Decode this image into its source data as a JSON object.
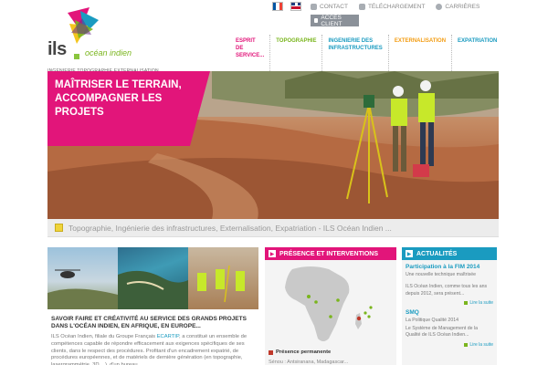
{
  "logo": {
    "name": "ils",
    "suffix": "océan indien",
    "tagline": "INGENIERIE TOPOGRAPHIE EXTERNALISATION"
  },
  "languages": [
    "fr",
    "en"
  ],
  "top_links": {
    "contact": "CONTACT",
    "telechargement": "TÉLÉCHARGEMENT",
    "carrieres": "CARRIÈRES",
    "acces_client": "ACCÈS CLIENT"
  },
  "nav": {
    "items": [
      {
        "label": "ESPRIT DE SERVICE..."
      },
      {
        "label": "TOPOGRAPHIE"
      },
      {
        "label": "INGENIERIE DES INFRASTRUCTURES"
      },
      {
        "label": "EXTERNALISATION"
      },
      {
        "label": "EXPATRIATION"
      }
    ]
  },
  "hero": {
    "headline": "MAÎTRISER LE TERRAIN, ACCOMPAGNER LES PROJETS"
  },
  "tagline": "Topographie, Ingénierie des infrastructures, Externalisation, Expatriation - ILS Océan Indien ...",
  "savoir": {
    "title": "SAVOIR FAIRE ET CRÉATIVITÉ AU SERVICE DES GRANDS PROJETS DANS L'OCÉAN INDIEN, EN AFRIQUE, EN EUROPE...",
    "text_before": "ILS Océan Indien, filiale du Groupe Français ",
    "link": "ECARTIP",
    "text_after": ", a constitué un ensemble de compétences capable de répondre efficacement aux exigences spécifiques de ses clients, dans le respect des procédures. Profitant d'un encadrement expatrié, de procédures européennes, et de matériels de dernière génération (en topographie, lasergrammétrie, 3D... ), d'un bureau"
  },
  "presence": {
    "title": "PRÉSENCE ET INTERVENTIONS",
    "legend": "Présence permanente",
    "sub": "Sénou : Antsiranana, Madagascar..."
  },
  "actualites": {
    "title": "ACTUALITÉS",
    "items": [
      {
        "title": "Participation à la FIM 2014",
        "subtitle": "Une nouvelle technique maîtrisée",
        "text": "ILS Océan Indien, comme tous les ans depuis 2012, sera présent...",
        "more": "Lire la suite"
      },
      {
        "title": "SMQ",
        "subtitle": "La Politique Qualité 2014",
        "text": "Le Système de Management de la Qualité de ILS Océan Indien...",
        "more": "Lire la suite"
      }
    ]
  },
  "colors": {
    "pink": "#e2157a",
    "green": "#7ab51d",
    "blue": "#1a9bc0",
    "orange": "#f39c12"
  }
}
